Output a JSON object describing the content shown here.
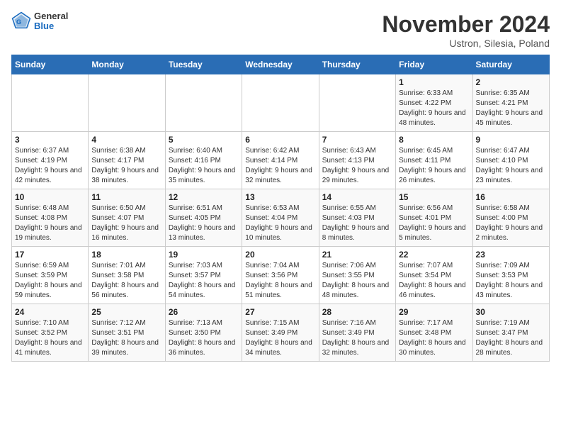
{
  "header": {
    "logo_general": "General",
    "logo_blue": "Blue",
    "month_title": "November 2024",
    "location": "Ustron, Silesia, Poland"
  },
  "weekdays": [
    "Sunday",
    "Monday",
    "Tuesday",
    "Wednesday",
    "Thursday",
    "Friday",
    "Saturday"
  ],
  "weeks": [
    [
      {
        "day": "",
        "sunrise": "",
        "sunset": "",
        "daylight": ""
      },
      {
        "day": "",
        "sunrise": "",
        "sunset": "",
        "daylight": ""
      },
      {
        "day": "",
        "sunrise": "",
        "sunset": "",
        "daylight": ""
      },
      {
        "day": "",
        "sunrise": "",
        "sunset": "",
        "daylight": ""
      },
      {
        "day": "",
        "sunrise": "",
        "sunset": "",
        "daylight": ""
      },
      {
        "day": "1",
        "sunrise": "Sunrise: 6:33 AM",
        "sunset": "Sunset: 4:22 PM",
        "daylight": "Daylight: 9 hours and 48 minutes."
      },
      {
        "day": "2",
        "sunrise": "Sunrise: 6:35 AM",
        "sunset": "Sunset: 4:21 PM",
        "daylight": "Daylight: 9 hours and 45 minutes."
      }
    ],
    [
      {
        "day": "3",
        "sunrise": "Sunrise: 6:37 AM",
        "sunset": "Sunset: 4:19 PM",
        "daylight": "Daylight: 9 hours and 42 minutes."
      },
      {
        "day": "4",
        "sunrise": "Sunrise: 6:38 AM",
        "sunset": "Sunset: 4:17 PM",
        "daylight": "Daylight: 9 hours and 38 minutes."
      },
      {
        "day": "5",
        "sunrise": "Sunrise: 6:40 AM",
        "sunset": "Sunset: 4:16 PM",
        "daylight": "Daylight: 9 hours and 35 minutes."
      },
      {
        "day": "6",
        "sunrise": "Sunrise: 6:42 AM",
        "sunset": "Sunset: 4:14 PM",
        "daylight": "Daylight: 9 hours and 32 minutes."
      },
      {
        "day": "7",
        "sunrise": "Sunrise: 6:43 AM",
        "sunset": "Sunset: 4:13 PM",
        "daylight": "Daylight: 9 hours and 29 minutes."
      },
      {
        "day": "8",
        "sunrise": "Sunrise: 6:45 AM",
        "sunset": "Sunset: 4:11 PM",
        "daylight": "Daylight: 9 hours and 26 minutes."
      },
      {
        "day": "9",
        "sunrise": "Sunrise: 6:47 AM",
        "sunset": "Sunset: 4:10 PM",
        "daylight": "Daylight: 9 hours and 23 minutes."
      }
    ],
    [
      {
        "day": "10",
        "sunrise": "Sunrise: 6:48 AM",
        "sunset": "Sunset: 4:08 PM",
        "daylight": "Daylight: 9 hours and 19 minutes."
      },
      {
        "day": "11",
        "sunrise": "Sunrise: 6:50 AM",
        "sunset": "Sunset: 4:07 PM",
        "daylight": "Daylight: 9 hours and 16 minutes."
      },
      {
        "day": "12",
        "sunrise": "Sunrise: 6:51 AM",
        "sunset": "Sunset: 4:05 PM",
        "daylight": "Daylight: 9 hours and 13 minutes."
      },
      {
        "day": "13",
        "sunrise": "Sunrise: 6:53 AM",
        "sunset": "Sunset: 4:04 PM",
        "daylight": "Daylight: 9 hours and 10 minutes."
      },
      {
        "day": "14",
        "sunrise": "Sunrise: 6:55 AM",
        "sunset": "Sunset: 4:03 PM",
        "daylight": "Daylight: 9 hours and 8 minutes."
      },
      {
        "day": "15",
        "sunrise": "Sunrise: 6:56 AM",
        "sunset": "Sunset: 4:01 PM",
        "daylight": "Daylight: 9 hours and 5 minutes."
      },
      {
        "day": "16",
        "sunrise": "Sunrise: 6:58 AM",
        "sunset": "Sunset: 4:00 PM",
        "daylight": "Daylight: 9 hours and 2 minutes."
      }
    ],
    [
      {
        "day": "17",
        "sunrise": "Sunrise: 6:59 AM",
        "sunset": "Sunset: 3:59 PM",
        "daylight": "Daylight: 8 hours and 59 minutes."
      },
      {
        "day": "18",
        "sunrise": "Sunrise: 7:01 AM",
        "sunset": "Sunset: 3:58 PM",
        "daylight": "Daylight: 8 hours and 56 minutes."
      },
      {
        "day": "19",
        "sunrise": "Sunrise: 7:03 AM",
        "sunset": "Sunset: 3:57 PM",
        "daylight": "Daylight: 8 hours and 54 minutes."
      },
      {
        "day": "20",
        "sunrise": "Sunrise: 7:04 AM",
        "sunset": "Sunset: 3:56 PM",
        "daylight": "Daylight: 8 hours and 51 minutes."
      },
      {
        "day": "21",
        "sunrise": "Sunrise: 7:06 AM",
        "sunset": "Sunset: 3:55 PM",
        "daylight": "Daylight: 8 hours and 48 minutes."
      },
      {
        "day": "22",
        "sunrise": "Sunrise: 7:07 AM",
        "sunset": "Sunset: 3:54 PM",
        "daylight": "Daylight: 8 hours and 46 minutes."
      },
      {
        "day": "23",
        "sunrise": "Sunrise: 7:09 AM",
        "sunset": "Sunset: 3:53 PM",
        "daylight": "Daylight: 8 hours and 43 minutes."
      }
    ],
    [
      {
        "day": "24",
        "sunrise": "Sunrise: 7:10 AM",
        "sunset": "Sunset: 3:52 PM",
        "daylight": "Daylight: 8 hours and 41 minutes."
      },
      {
        "day": "25",
        "sunrise": "Sunrise: 7:12 AM",
        "sunset": "Sunset: 3:51 PM",
        "daylight": "Daylight: 8 hours and 39 minutes."
      },
      {
        "day": "26",
        "sunrise": "Sunrise: 7:13 AM",
        "sunset": "Sunset: 3:50 PM",
        "daylight": "Daylight: 8 hours and 36 minutes."
      },
      {
        "day": "27",
        "sunrise": "Sunrise: 7:15 AM",
        "sunset": "Sunset: 3:49 PM",
        "daylight": "Daylight: 8 hours and 34 minutes."
      },
      {
        "day": "28",
        "sunrise": "Sunrise: 7:16 AM",
        "sunset": "Sunset: 3:49 PM",
        "daylight": "Daylight: 8 hours and 32 minutes."
      },
      {
        "day": "29",
        "sunrise": "Sunrise: 7:17 AM",
        "sunset": "Sunset: 3:48 PM",
        "daylight": "Daylight: 8 hours and 30 minutes."
      },
      {
        "day": "30",
        "sunrise": "Sunrise: 7:19 AM",
        "sunset": "Sunset: 3:47 PM",
        "daylight": "Daylight: 8 hours and 28 minutes."
      }
    ]
  ]
}
